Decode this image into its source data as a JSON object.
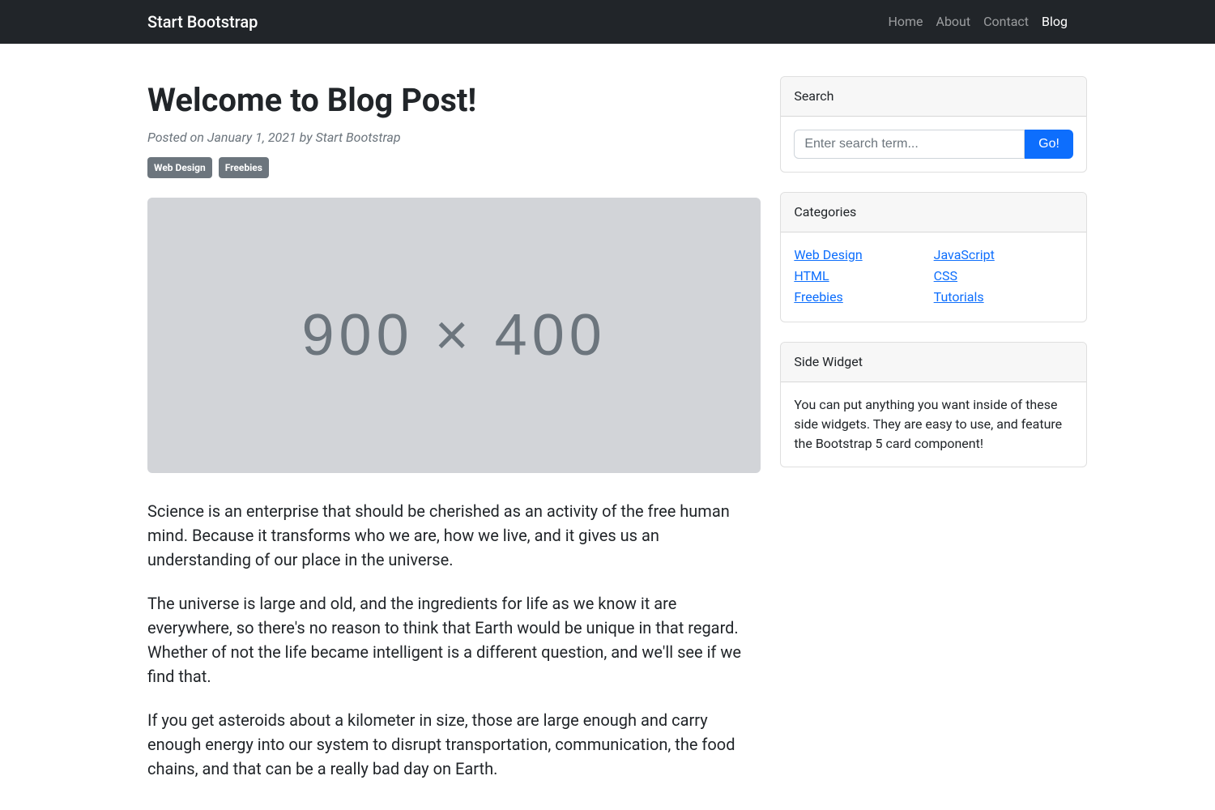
{
  "navbar": {
    "brand": "Start Bootstrap",
    "links": {
      "home": "Home",
      "about": "About",
      "contact": "Contact",
      "blog": "Blog"
    }
  },
  "post": {
    "title": "Welcome to Blog Post!",
    "meta": "Posted on January 1, 2021 by Start Bootstrap",
    "badges": {
      "web_design": "Web Design",
      "freebies": "Freebies"
    },
    "image_placeholder": "900 × 400",
    "paragraphs": {
      "p1": "Science is an enterprise that should be cherished as an activity of the free human mind. Because it transforms who we are, how we live, and it gives us an understanding of our place in the universe.",
      "p2": "The universe is large and old, and the ingredients for life as we know it are everywhere, so there's no reason to think that Earth would be unique in that regard. Whether of not the life became intelligent is a different question, and we'll see if we find that.",
      "p3": "If you get asteroids about a kilometer in size, those are large enough and carry enough energy into our system to disrupt transportation, communication, the food chains, and that can be a really bad day on Earth."
    }
  },
  "sidebar": {
    "search": {
      "header": "Search",
      "placeholder": "Enter search term...",
      "button": "Go!"
    },
    "categories": {
      "header": "Categories",
      "col1": {
        "web_design": "Web Design",
        "html": "HTML",
        "freebies": "Freebies"
      },
      "col2": {
        "javascript": "JavaScript",
        "css": "CSS",
        "tutorials": "Tutorials"
      }
    },
    "widget": {
      "header": "Side Widget",
      "text": "You can put anything you want inside of these side widgets. They are easy to use, and feature the Bootstrap 5 card component!"
    }
  }
}
